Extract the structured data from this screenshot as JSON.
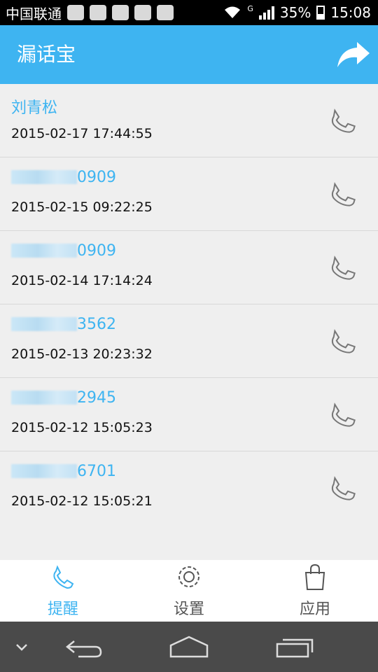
{
  "status_bar": {
    "carrier": "中国联通",
    "battery": "35%",
    "time": "15:08",
    "signal_marker": "G"
  },
  "app_bar": {
    "title": "漏话宝",
    "share_icon": "share-arrow-icon"
  },
  "calls": [
    {
      "name": "刘青松",
      "masked": false,
      "number_suffix": "",
      "time": "2015-02-17 17:44:55"
    },
    {
      "name": "",
      "masked": true,
      "number_suffix": "0909",
      "time": "2015-02-15 09:22:25"
    },
    {
      "name": "",
      "masked": true,
      "number_suffix": "0909",
      "time": "2015-02-14 17:14:24"
    },
    {
      "name": "",
      "masked": true,
      "number_suffix": "3562",
      "time": "2015-02-13 20:23:32"
    },
    {
      "name": "",
      "masked": true,
      "number_suffix": "2945",
      "time": "2015-02-12 15:05:23"
    },
    {
      "name": "",
      "masked": true,
      "number_suffix": "6701",
      "time": "2015-02-12 15:05:21"
    }
  ],
  "tabs": [
    {
      "label": "提醒",
      "icon": "phone-icon",
      "active": true
    },
    {
      "label": "设置",
      "icon": "gear-icon",
      "active": false
    },
    {
      "label": "应用",
      "icon": "shopping-bag-icon",
      "active": false
    }
  ],
  "colors": {
    "accent": "#3eb4f1",
    "inactive": "#555555",
    "background": "#efefef",
    "nav": "#4a4a4a"
  }
}
